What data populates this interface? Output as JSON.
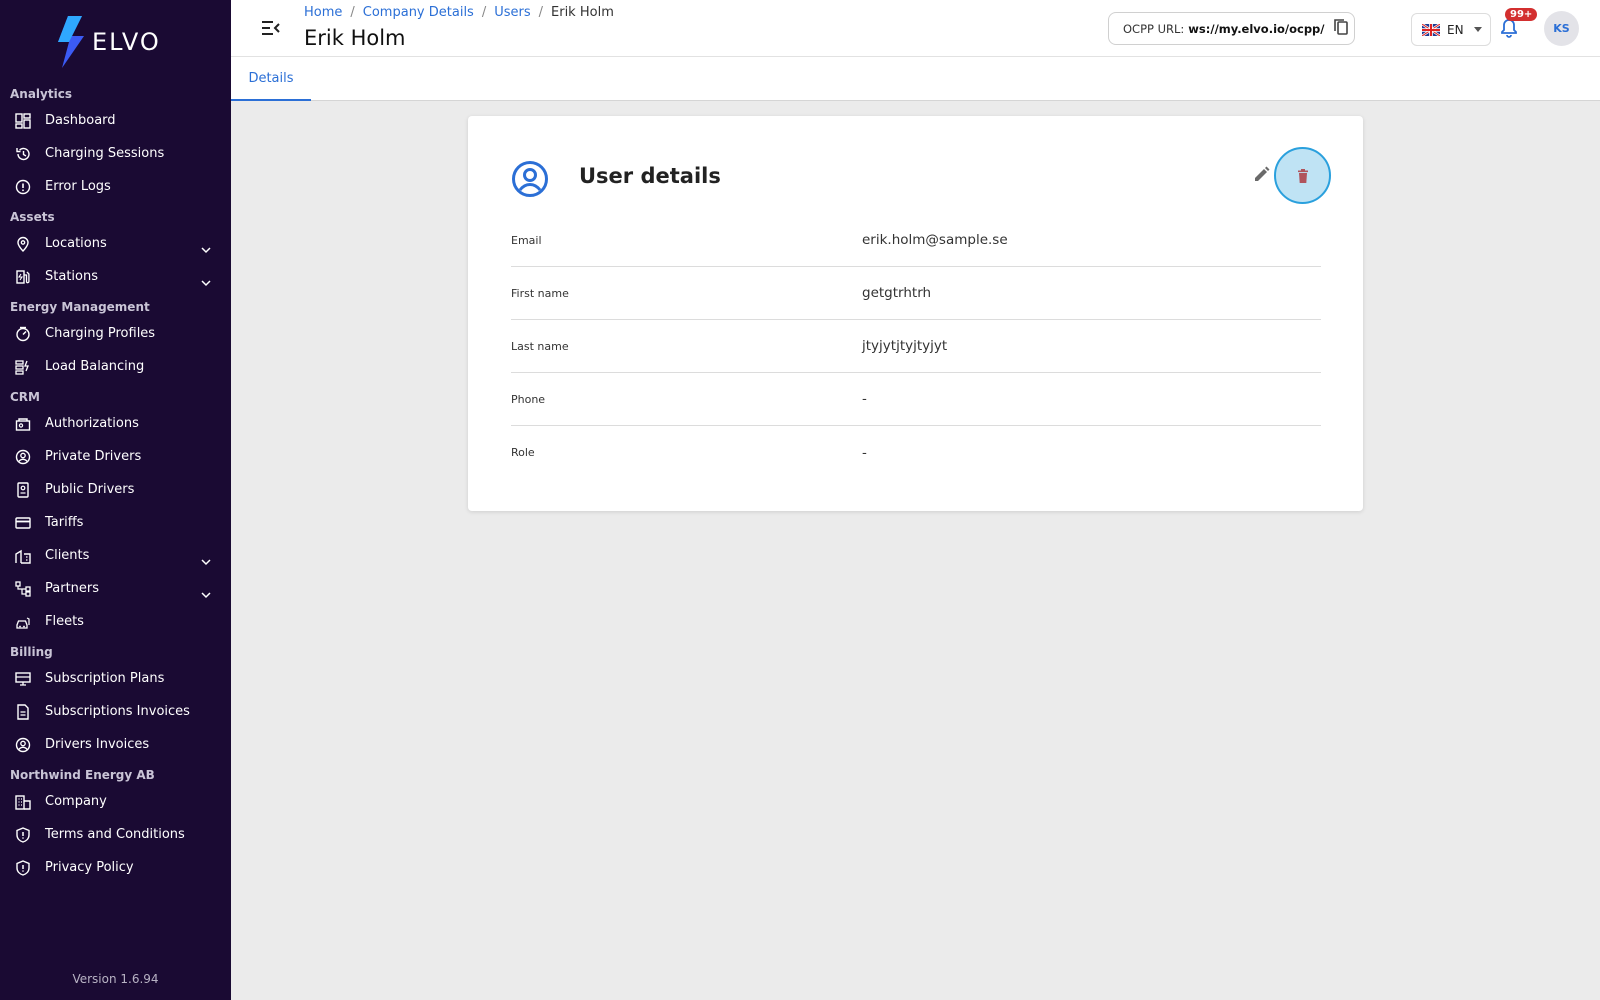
{
  "app": {
    "brand": "ELVO",
    "version": "Version 1.6.94"
  },
  "sidebar": {
    "sections": [
      {
        "title": "Analytics",
        "items": [
          {
            "label": "Dashboard",
            "icon": "dashboard-icon"
          },
          {
            "label": "Charging Sessions",
            "icon": "history-icon"
          },
          {
            "label": "Error Logs",
            "icon": "error-icon"
          }
        ]
      },
      {
        "title": "Assets",
        "items": [
          {
            "label": "Locations",
            "icon": "location-pin-icon",
            "expandable": true
          },
          {
            "label": "Stations",
            "icon": "ev-station-icon",
            "expandable": true
          }
        ]
      },
      {
        "title": "Energy Management",
        "items": [
          {
            "label": "Charging Profiles",
            "icon": "gauge-icon"
          },
          {
            "label": "Load Balancing",
            "icon": "load-balancing-icon"
          }
        ]
      },
      {
        "title": "CRM",
        "items": [
          {
            "label": "Authorizations",
            "icon": "authorizations-icon"
          },
          {
            "label": "Private Drivers",
            "icon": "user-circle-icon"
          },
          {
            "label": "Public Drivers",
            "icon": "badge-icon"
          },
          {
            "label": "Tariffs",
            "icon": "card-icon"
          },
          {
            "label": "Clients",
            "icon": "building-icon",
            "expandable": true
          },
          {
            "label": "Partners",
            "icon": "network-icon",
            "expandable": true
          },
          {
            "label": "Fleets",
            "icon": "car-icon"
          }
        ]
      },
      {
        "title": "Billing",
        "items": [
          {
            "label": "Subscription Plans",
            "icon": "monitor-icon"
          },
          {
            "label": "Subscriptions Invoices",
            "icon": "document-icon"
          },
          {
            "label": "Drivers Invoices",
            "icon": "user-circle-icon"
          }
        ]
      },
      {
        "title": "Northwind Energy AB",
        "items": [
          {
            "label": "Company",
            "icon": "company-icon"
          },
          {
            "label": "Terms and Conditions",
            "icon": "shield-icon"
          },
          {
            "label": "Privacy Policy",
            "icon": "shield-icon"
          }
        ]
      }
    ]
  },
  "header": {
    "breadcrumb": [
      "Home",
      "Company Details",
      "Users"
    ],
    "breadcrumb_current": "Erik Holm",
    "title": "Erik Holm",
    "ocpp_label": "OCPP URL:",
    "ocpp_value": "ws://my.elvo.io/ocpp/",
    "language": "EN",
    "notifications_badge": "99+",
    "avatar_initials": "KS"
  },
  "tabs": [
    {
      "label": "Details",
      "active": true
    }
  ],
  "card": {
    "title": "User details",
    "fields": [
      {
        "label": "Email",
        "value": "erik.holm@sample.se"
      },
      {
        "label": "First name",
        "value": "getgtrhtrh"
      },
      {
        "label": "Last name",
        "value": "jtyjytjtyjtyjyt"
      },
      {
        "label": "Phone",
        "value": "-"
      },
      {
        "label": "Role",
        "value": "-"
      }
    ]
  },
  "colors": {
    "sidebar_bg": "#1a0a33",
    "accent": "#2b6fd6",
    "delete_red": "#b0545c",
    "badge_red": "#d32f2f"
  }
}
